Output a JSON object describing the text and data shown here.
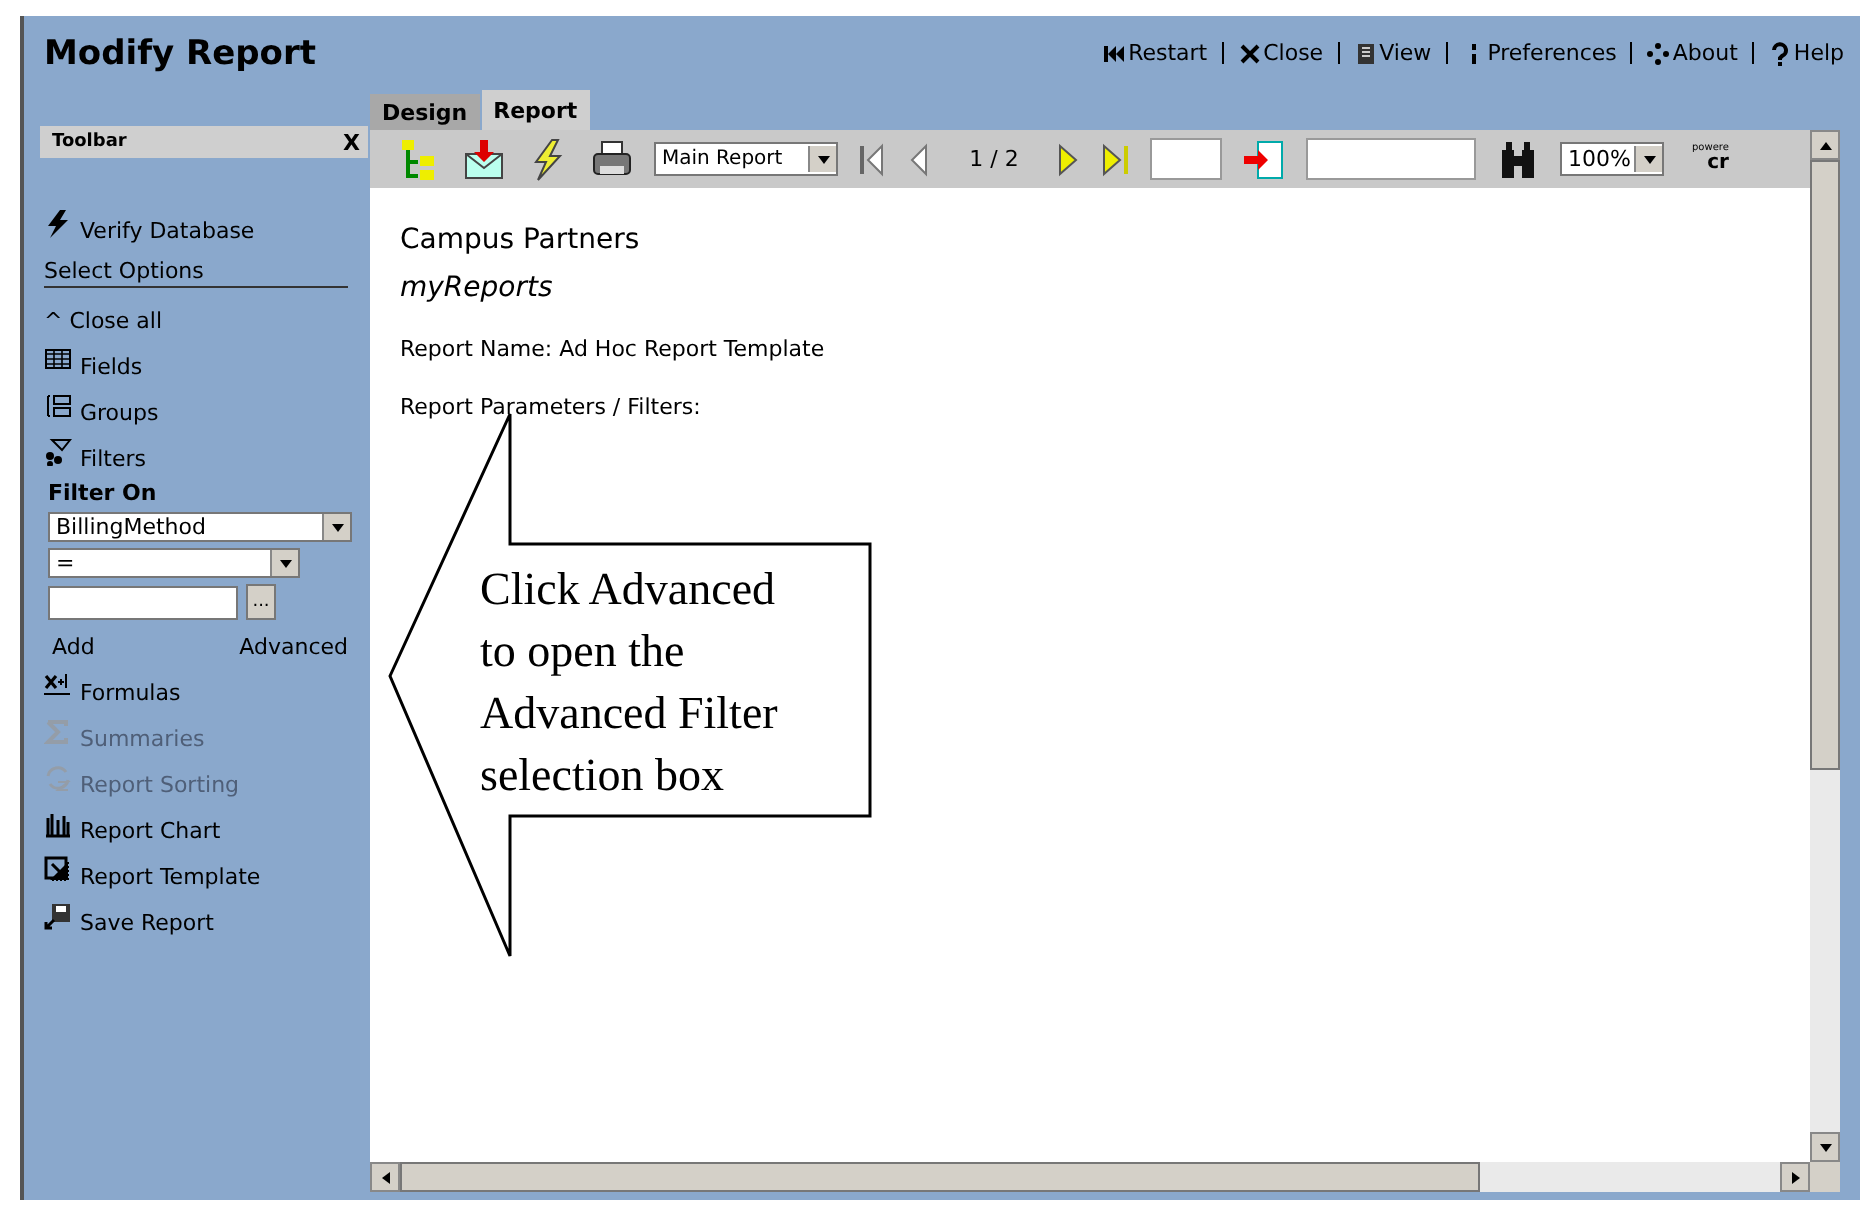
{
  "window": {
    "title": "Modify Report"
  },
  "top_links": [
    {
      "label": "Restart",
      "kind": "restart"
    },
    {
      "label": "Close",
      "kind": "close"
    },
    {
      "label": "View",
      "kind": "view"
    },
    {
      "label": "Preferences",
      "kind": "preferences"
    },
    {
      "label": "About",
      "kind": "about"
    },
    {
      "label": "Help",
      "kind": "help"
    }
  ],
  "tabs": [
    {
      "label": "Design",
      "selected": false
    },
    {
      "label": "Report",
      "selected": true
    }
  ],
  "sidebar": {
    "panel_title": "Toolbar",
    "panel_close": "X",
    "items": [
      {
        "kind": "verify",
        "label": "Verify Database",
        "disabled": false
      },
      {
        "kind": "section",
        "label": "Select Options"
      },
      {
        "kind": "close_all",
        "label": "^ Close all",
        "disabled": false
      },
      {
        "kind": "fields",
        "label": "Fields",
        "disabled": false
      },
      {
        "kind": "groups",
        "label": "Groups",
        "disabled": false
      },
      {
        "kind": "filters",
        "label": "Filters",
        "disabled": false
      },
      {
        "kind": "filter_form",
        "label": "Filter On",
        "field": "BillingMethod",
        "operator": "=",
        "value_button": "...",
        "add": "Add",
        "advanced": "Advanced"
      },
      {
        "kind": "formulas",
        "label": "Formulas",
        "disabled": false
      },
      {
        "kind": "summaries",
        "label": "Summaries",
        "disabled": true
      },
      {
        "kind": "sorting",
        "label": "Report Sorting",
        "disabled": true
      },
      {
        "kind": "chart",
        "label": "Report Chart",
        "disabled": false
      },
      {
        "kind": "template",
        "label": "Report Template",
        "disabled": false
      },
      {
        "kind": "save",
        "label": "Save Report",
        "disabled": false
      }
    ]
  },
  "toolbar": {
    "report_select": "Main Report",
    "page": "1 / 2",
    "zoom_select": "100%",
    "powered_by": "powere",
    "brand": "cr"
  },
  "report": {
    "heading": "Campus Partners",
    "subtitle": "myReports",
    "lines": [
      "Report Name:  Ad Hoc Report Template",
      "Report Parameters / Filters:"
    ]
  },
  "callout": {
    "lines": [
      "Click Advanced",
      "to open the",
      "Advanced Filter",
      "selection box"
    ]
  }
}
